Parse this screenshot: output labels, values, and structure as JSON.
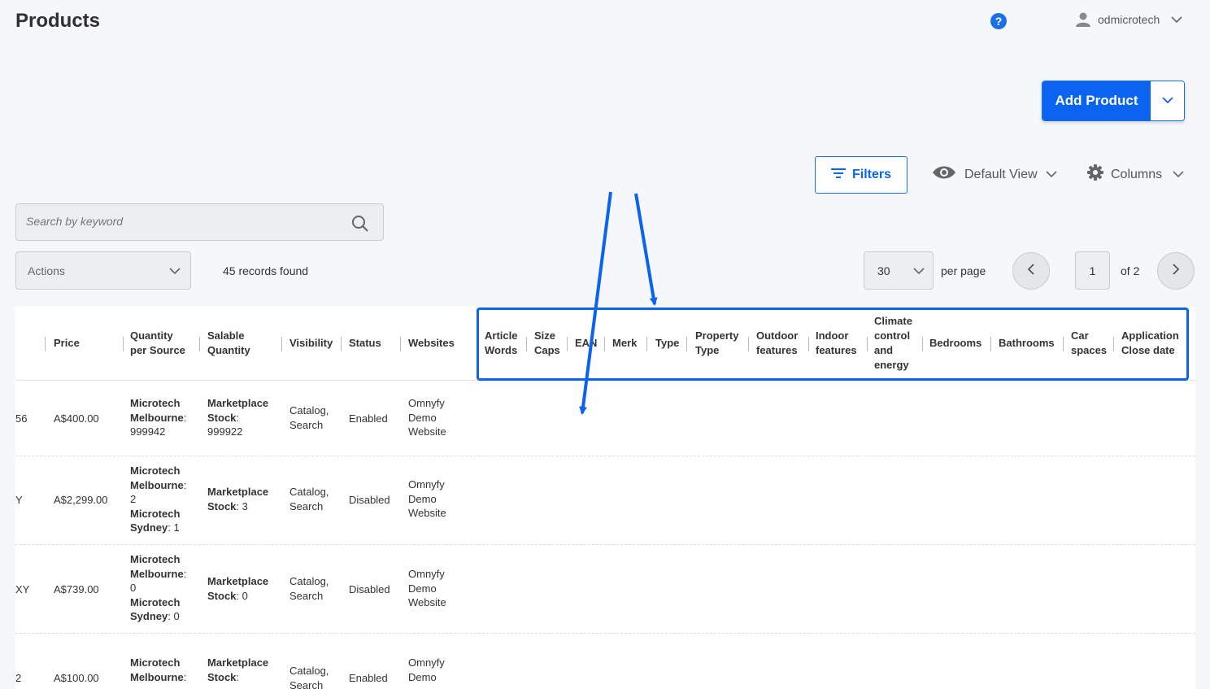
{
  "header": {
    "title": "Products",
    "help_label": "?",
    "username": "odmicrotech"
  },
  "toolbar": {
    "add_product_label": "Add Product",
    "filters_label": "Filters",
    "view_label": "Default View",
    "columns_label": "Columns"
  },
  "search": {
    "placeholder": "Search by keyword"
  },
  "actions": {
    "label": "Actions"
  },
  "records": {
    "text": "45 records found"
  },
  "pagination": {
    "per_page_value": "30",
    "per_page_label": "per page",
    "current_page": "1",
    "of_pages": "of 2"
  },
  "table": {
    "columns": {
      "price": "Price",
      "quantity_per_source": [
        "Quantity",
        "per Source"
      ],
      "salable_quantity": [
        "Salable",
        "Quantity"
      ],
      "visibility": "Visibility",
      "status": "Status",
      "websites": "Websites",
      "article_words": [
        "Article",
        "Words"
      ],
      "size_caps": [
        "Size",
        "Caps"
      ],
      "ean": "EAN",
      "merk": "Merk",
      "type": "Type",
      "property_type": [
        "Property",
        "Type"
      ],
      "outdoor_features": [
        "Outdoor",
        "features"
      ],
      "indoor_features": [
        "Indoor",
        "features"
      ],
      "climate_control": [
        "Climate",
        "control",
        "and",
        "energy"
      ],
      "bedrooms": "Bedrooms",
      "bathrooms": "Bathrooms",
      "car_spaces": [
        "Car",
        "spaces"
      ],
      "application_close_date": [
        "Application",
        "Close date"
      ]
    },
    "rows": [
      {
        "partial": "56",
        "price": "A$400.00",
        "qty_lines": [
          [
            "Microtech",
            ""
          ],
          [
            "Melbourne",
            ":"
          ],
          [
            "",
            "999942"
          ]
        ],
        "salable_lines": [
          [
            "Marketplace",
            ""
          ],
          [
            "Stock",
            ":"
          ],
          [
            "",
            "999922"
          ]
        ],
        "visibility": [
          "Catalog,",
          "Search"
        ],
        "status": "Enabled",
        "websites": [
          "Omnyfy",
          "Demo",
          "Website"
        ]
      },
      {
        "partial": "Y",
        "price": "A$2,299.00",
        "qty_lines": [
          [
            "Microtech",
            ""
          ],
          [
            "Melbourne",
            ":"
          ],
          [
            "",
            "2"
          ],
          [
            "Microtech",
            ""
          ],
          [
            "Sydney",
            ": 1"
          ]
        ],
        "salable_lines": [
          [
            "Marketplace",
            ""
          ],
          [
            "Stock",
            ": 3"
          ]
        ],
        "visibility": [
          "Catalog,",
          "Search"
        ],
        "status": "Disabled",
        "websites": [
          "Omnyfy",
          "Demo",
          "Website"
        ]
      },
      {
        "partial": "XY",
        "price": "A$739.00",
        "qty_lines": [
          [
            "Microtech",
            ""
          ],
          [
            "Melbourne",
            ":"
          ],
          [
            "",
            "0"
          ],
          [
            "Microtech",
            ""
          ],
          [
            "Sydney",
            ": 0"
          ]
        ],
        "salable_lines": [
          [
            "Marketplace",
            ""
          ],
          [
            "Stock",
            ": 0"
          ]
        ],
        "visibility": [
          "Catalog,",
          "Search"
        ],
        "status": "Disabled",
        "websites": [
          "Omnyfy",
          "Demo",
          "Website"
        ]
      },
      {
        "partial": "2",
        "price": "A$100.00",
        "qty_lines": [
          [
            "Microtech",
            ""
          ],
          [
            "Melbourne",
            ":"
          ]
        ],
        "salable_lines": [
          [
            "Marketplace",
            ""
          ],
          [
            "Stock",
            ":"
          ]
        ],
        "visibility": [
          "Catalog,",
          "Search"
        ],
        "status": "Enabled",
        "websites": [
          "Omnyfy",
          "Demo"
        ]
      }
    ]
  },
  "colors": {
    "accent": "#0a64f0",
    "background": "#f5f7fb"
  },
  "icons": [
    "help-icon",
    "user-icon",
    "chevron-down-icon",
    "filter-icon",
    "eye-icon",
    "gear-icon",
    "search-icon",
    "chevron-left-icon",
    "chevron-right-icon"
  ]
}
